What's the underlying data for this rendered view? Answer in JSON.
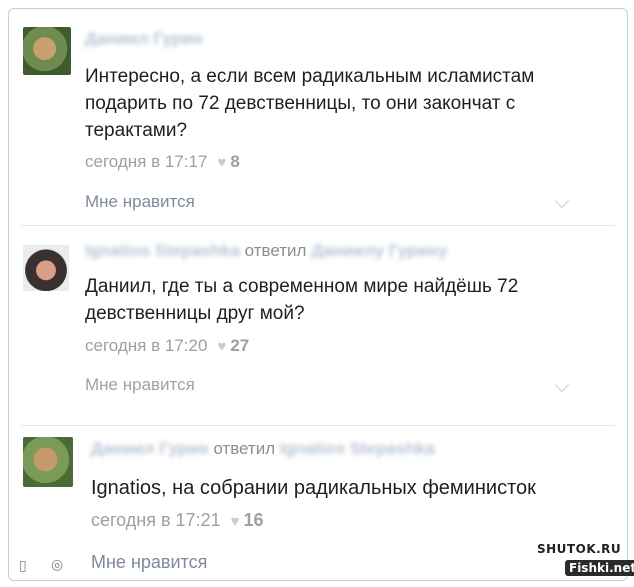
{
  "comments": [
    {
      "author": "Даниил Гурин",
      "replied_label": "",
      "reply_to": "",
      "text": "Интересно, а если всем радикальным исламистам подарить по 72 девственницы, то они закончат с терактами?",
      "time": "сегодня в 17:17",
      "likes": "8",
      "like_label": "Мне нравится"
    },
    {
      "author": "Ignatios Stepashka",
      "replied_label": "ответил",
      "reply_to": "Даниилу Гурину",
      "text": "Даниил, где ты а современном мире найдёшь 72 девственницы друг мой?",
      "time": "сегодня в 17:20",
      "likes": "27",
      "like_label": "Мне нравится"
    },
    {
      "author": "Даниил Гурин",
      "replied_label": "ответил",
      "reply_to": "Ignatios Stepashka",
      "text": "Ignatios, на собрании радикальных феминисток",
      "time": "сегодня в 17:21",
      "likes": "16",
      "like_label": "Мне нравится"
    }
  ],
  "watermarks": {
    "shutok": "SHUTOK.RU",
    "fishki": "Fishki.net"
  },
  "icons": [
    "heart-icon",
    "chevron-down-icon",
    "avatar",
    "bookmark-icon",
    "camera-icon"
  ]
}
